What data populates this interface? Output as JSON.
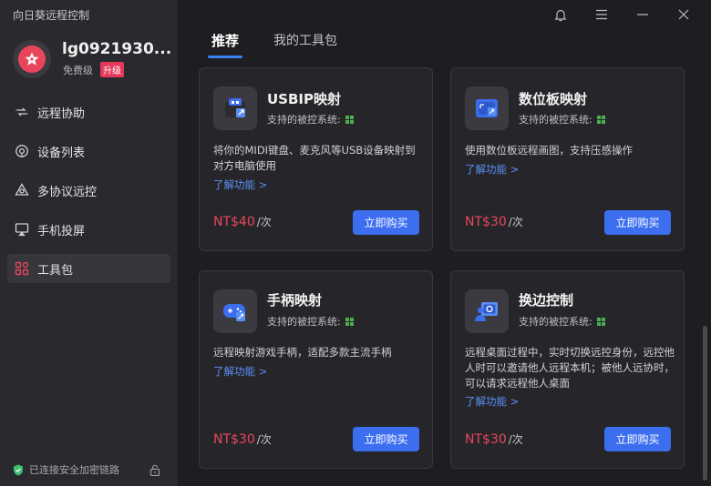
{
  "app": {
    "title": "向日葵远程控制"
  },
  "user": {
    "name": "lg0921930...",
    "level": "免费级",
    "upgrade_label": "升级"
  },
  "sidebar": {
    "items": [
      {
        "label": "远程协助",
        "icon": "remote-assist-icon",
        "active": false
      },
      {
        "label": "设备列表",
        "icon": "device-list-icon",
        "active": false
      },
      {
        "label": "多协议远控",
        "icon": "multi-protocol-icon",
        "active": false
      },
      {
        "label": "手机投屏",
        "icon": "screen-cast-icon",
        "active": false
      },
      {
        "label": "工具包",
        "icon": "toolkit-icon",
        "active": true
      }
    ],
    "secure_text": "已连接安全加密链路"
  },
  "tabs": [
    {
      "label": "推荐",
      "active": true
    },
    {
      "label": "我的工具包",
      "active": false
    }
  ],
  "cards": [
    {
      "title": "USBIP映射",
      "support": "支持的被控系统:",
      "desc": "将你的MIDI键盘、麦克风等USB设备映射到对方电脑使用",
      "link": "了解功能 >",
      "price": "NT$40",
      "unit": "/次",
      "buy": "立即购买",
      "icon": "usb-icon"
    },
    {
      "title": "数位板映射",
      "support": "支持的被控系统:",
      "desc": "使用数位板远程画图，支持压感操作",
      "link": "了解功能 >",
      "price": "NT$30",
      "unit": "/次",
      "buy": "立即购买",
      "icon": "tablet-icon"
    },
    {
      "title": "手柄映射",
      "support": "支持的被控系统:",
      "desc": "远程映射游戏手柄，适配多款主流手柄",
      "link": "了解功能 >",
      "price": "NT$30",
      "unit": "/次",
      "buy": "立即购买",
      "icon": "gamepad-icon"
    },
    {
      "title": "换边控制",
      "support": "支持的被控系统:",
      "desc": "远程桌面过程中，实时切换远控身份，远控他人时可以邀请他人远程本机；被他人远协时，可以请求远程他人桌面",
      "link": "了解功能 >",
      "price": "NT$30",
      "unit": "/次",
      "buy": "立即购买",
      "icon": "switch-control-icon"
    }
  ],
  "colors": {
    "accent": "#3c6ef0",
    "price": "#e8455c",
    "link": "#5a8ff5",
    "windows": "#4caf50"
  }
}
